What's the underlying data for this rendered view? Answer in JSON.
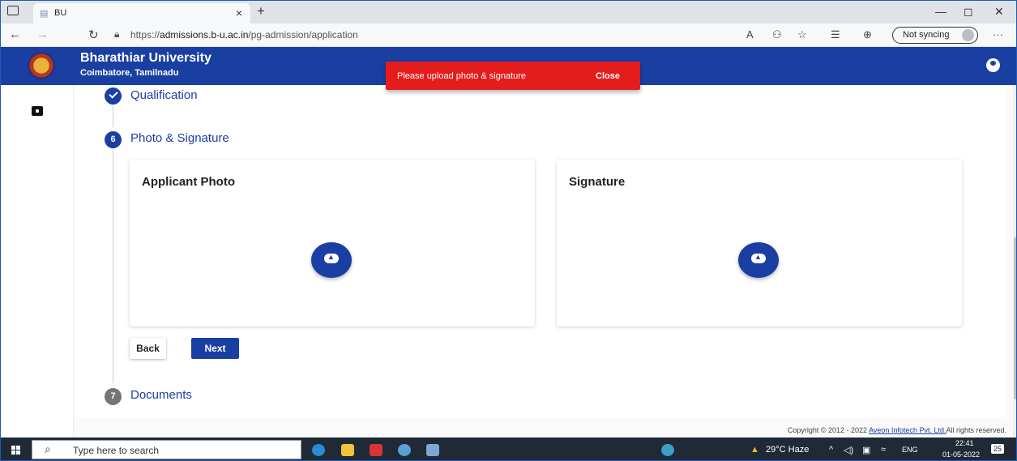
{
  "browser": {
    "tab_title": "BU",
    "url_prefix": "https://",
    "url_host": "admissions.b-u.ac.in",
    "url_path": "/pg-admission/application",
    "sync_label": "Not syncing"
  },
  "header": {
    "university": "Bharathiar University",
    "location": "Coimbatore, Tamilnadu"
  },
  "toast": {
    "message": "Please upload photo & signature",
    "close_label": "Close"
  },
  "steps": {
    "qualification": {
      "label": "Qualification"
    },
    "photo": {
      "number": "6",
      "label": "Photo & Signature"
    },
    "documents": {
      "number": "7",
      "label": "Documents"
    }
  },
  "cards": {
    "photo_title": "Applicant Photo",
    "signature_title": "Signature"
  },
  "buttons": {
    "back": "Back",
    "next": "Next"
  },
  "footer": {
    "prefix": "Copyright © 2012 - 2022 ",
    "link": "Aveon Infotech Pvt. Ltd.",
    "suffix": "All rights reserved."
  },
  "taskbar": {
    "search_placeholder": "Type here to search",
    "weather": "29°C  Haze",
    "lang": "ENG",
    "time": "22:41",
    "date": "01-05-2022",
    "notifications": "25"
  },
  "colors": {
    "primary": "#1a3fa3",
    "toast": "#e51c1c"
  }
}
